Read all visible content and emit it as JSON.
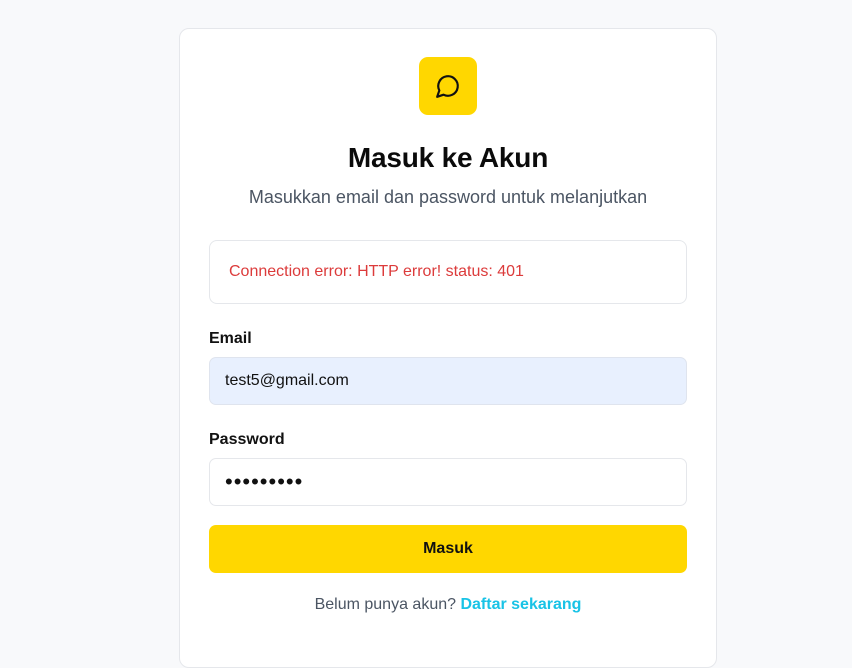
{
  "login": {
    "title": "Masuk ke Akun",
    "subtitle": "Masukkan email dan password untuk melanjutkan",
    "error_message": "Connection error: HTTP error! status: 401",
    "email_label": "Email",
    "email_value": "test5@gmail.com",
    "password_label": "Password",
    "password_value": "•••••••••",
    "submit_label": "Masuk",
    "signup_prompt": "Belum punya akun?",
    "signup_link": "Daftar sekarang"
  },
  "icons": {
    "logo": "chat-bubble-icon"
  },
  "colors": {
    "accent": "#ffd700",
    "error": "#dc3b3b",
    "link": "#19c3e6",
    "autofill_bg": "#e8f0fe"
  }
}
